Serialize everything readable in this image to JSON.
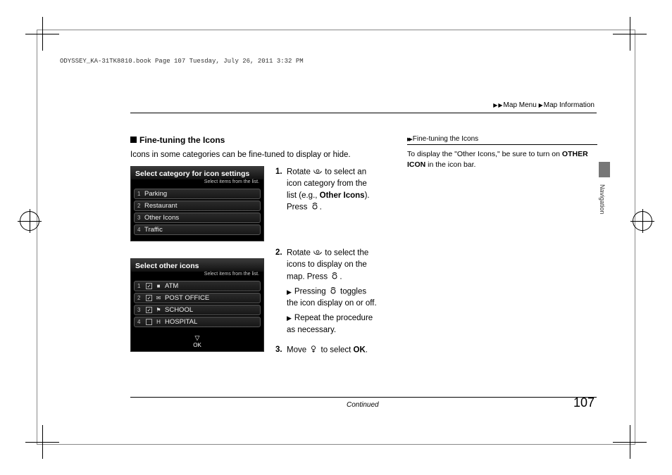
{
  "header_line": "ODYSSEY_KA-31TK8810.book  Page 107  Tuesday, July 26, 2011  3:32 PM",
  "breadcrumb": {
    "item1": "Map Menu",
    "item2": "Map Information"
  },
  "section_title": "Fine-tuning the Icons",
  "intro": "Icons in some categories can be fine-tuned to display or hide.",
  "screen1": {
    "title": "Select category for icon settings",
    "subtitle": "Select items from the list.",
    "rows": [
      {
        "n": "1",
        "label": "Parking"
      },
      {
        "n": "2",
        "label": "Restaurant"
      },
      {
        "n": "3",
        "label": "Other Icons"
      },
      {
        "n": "4",
        "label": "Traffic"
      }
    ]
  },
  "screen2": {
    "title": "Select other icons",
    "subtitle": "Select items from the list.",
    "rows": [
      {
        "n": "1",
        "checked": true,
        "glyph": "■",
        "label": "ATM"
      },
      {
        "n": "2",
        "checked": true,
        "glyph": "✉",
        "label": "POST OFFICE"
      },
      {
        "n": "3",
        "checked": true,
        "glyph": "⚑",
        "label": "SCHOOL"
      },
      {
        "n": "4",
        "checked": false,
        "glyph": "H",
        "label": "HOSPITAL"
      }
    ],
    "ok_label": "OK"
  },
  "steps": {
    "s1a": "Rotate ",
    "s1b": " to select an icon category from the list (e.g., ",
    "s1_bold": "Other Icons",
    "s1c": "). Press ",
    "s1d": ".",
    "s2a": "Rotate ",
    "s2b": " to select the icons to display on the map. Press ",
    "s2c": ".",
    "s2_sub1a": "Pressing ",
    "s2_sub1b": " toggles the icon display on or off.",
    "s2_sub2": "Repeat the procedure as necessary.",
    "s3a": "Move ",
    "s3b": " to select ",
    "s3_bold": "OK",
    "s3c": "."
  },
  "right_panel": {
    "title": "Fine-tuning the Icons",
    "body_a": "To display the \"Other Icons,\" be sure to turn on ",
    "body_bold": "OTHER ICON",
    "body_b": " in the icon bar."
  },
  "side_label": "Navigation",
  "continued": "Continued",
  "page_number": "107"
}
